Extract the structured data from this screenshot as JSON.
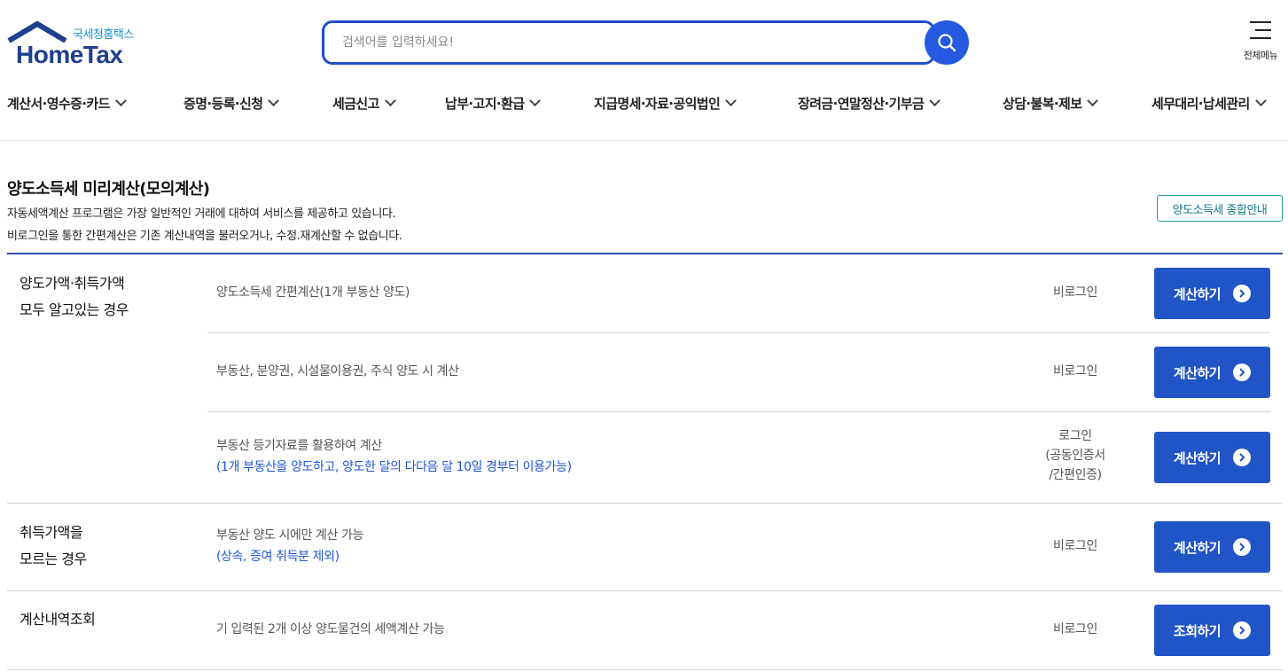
{
  "header": {
    "logo_sub": "국세청홈택스",
    "logo_main": "HomeTax",
    "search_placeholder": "검색어를 입력하세요!",
    "all_menu_label": "전체메뉴"
  },
  "nav": {
    "items": [
      "계산서·영수증·카드",
      "증명·등록·신청",
      "세금신고",
      "납부·고지·환급",
      "지급명세·자료·공익법인",
      "장려금·연말정산·기부금",
      "상담·불복·제보",
      "세무대리·납세관리"
    ]
  },
  "page": {
    "title": "양도소득세 미리계산(모의계산)",
    "desc1": "자동세액계산 프로그램은 가장 일반적인 거래에 대하여 서비스를 제공하고 있습니다.",
    "desc2": "비로그인을 통한 간편계산은 기존 계산내역을 불러오거나, 수정.재계산할 수 없습니다.",
    "guide_button": "양도소득세 종합안내"
  },
  "table": {
    "categories": [
      {
        "line1": "양도가액·취득가액",
        "line2": "모두 알고있는 경우"
      },
      {
        "line1": "취득가액을",
        "line2": "모르는 경우"
      },
      {
        "line1": "계산내역조회",
        "line2": ""
      }
    ],
    "rows": [
      {
        "text": "양도소득세 간편계산(1개 부동산 양도)",
        "note": "",
        "login1": "비로그인",
        "login2": "",
        "login3": "",
        "button": "계산하기"
      },
      {
        "text": "부동산, 분양권, 시설물이용권, 주식 양도 시 계산",
        "note": "",
        "login1": "비로그인",
        "login2": "",
        "login3": "",
        "button": "계산하기"
      },
      {
        "text": "부동산 등기자료를 활용하여 계산",
        "note": "(1개 부동산을 양도하고, 양도한 달의 다다음 달 10일 경부터 이용가능)",
        "login1": "로그인",
        "login2": "(공동인증서",
        "login3": "/간편인증)",
        "button": "계산하기"
      },
      {
        "text": "부동산 양도 시에만 계산 가능",
        "note": "(상속, 증여 취득분 제외)",
        "login1": "비로그인",
        "login2": "",
        "login3": "",
        "button": "계산하기"
      },
      {
        "text": "기 입력된 2개 이상 양도물건의 세액계산 가능",
        "note": "",
        "login1": "비로그인",
        "login2": "",
        "login3": "",
        "button": "조회하기"
      }
    ]
  }
}
